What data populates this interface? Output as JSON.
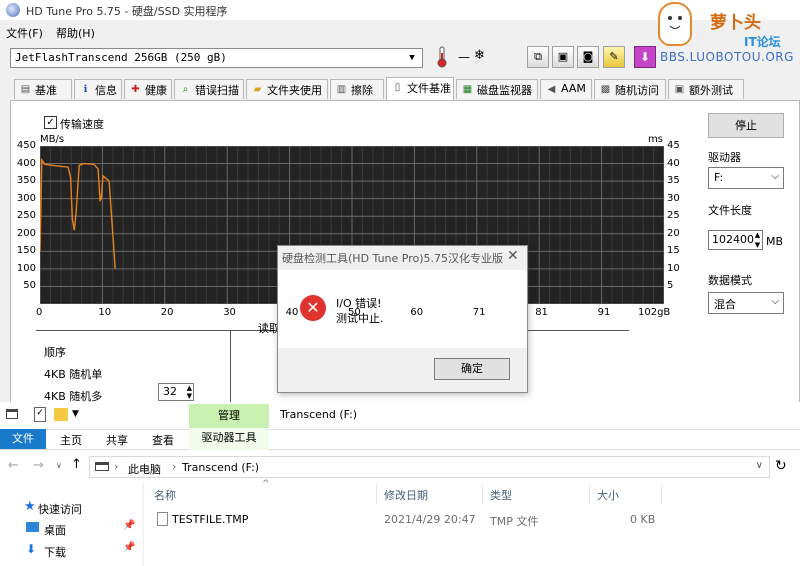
{
  "window": {
    "title": "HD Tune Pro 5.75 - 硬盘/SSD 实用程序",
    "menu": [
      "文件(F)",
      "帮助(H)"
    ],
    "drive": "JetFlashTranscend 256GB (250 gB)",
    "temperature": "—"
  },
  "watermark": {
    "title": "萝卜头",
    "subtitle": "IT论坛",
    "url": "BBS.LUOBOTOU.ORG"
  },
  "tabs": [
    {
      "label": "基准",
      "icon": "ruler-icon"
    },
    {
      "label": "信息",
      "icon": "info-icon"
    },
    {
      "label": "健康",
      "icon": "health-cross-icon"
    },
    {
      "label": "错误扫描",
      "icon": "magnifier-icon"
    },
    {
      "label": "文件夹使用",
      "icon": "folder-icon"
    },
    {
      "label": "擦除",
      "icon": "trash-icon"
    },
    {
      "label": "文件基准",
      "icon": "file-icon"
    },
    {
      "label": "磁盘监视器",
      "icon": "monitor-icon"
    },
    {
      "label": "AAM",
      "icon": "speaker-icon"
    },
    {
      "label": "随机访问",
      "icon": "random-icon"
    },
    {
      "label": "额外测试",
      "icon": "extra-icon"
    }
  ],
  "benchmark": {
    "checkbox_label": "传输速度",
    "checked": true,
    "left_unit": "MB/s",
    "right_unit": "ms",
    "section_label": "读取",
    "list_header": "顺序",
    "rows": [
      "4KB 随机单",
      "4KB 随机多"
    ],
    "queue_depth": "32"
  },
  "chart_data": {
    "type": "line",
    "xlabel": "",
    "ylabel": "MB/s",
    "y2label": "ms",
    "xlim": [
      0,
      102
    ],
    "ylim": [
      0,
      450
    ],
    "y2lim": [
      0,
      45
    ],
    "x_ticks": [
      "0",
      "10",
      "20",
      "30",
      "40",
      "50",
      "60",
      "71",
      "81",
      "91",
      "102gB"
    ],
    "y_ticks": [
      "450",
      "400",
      "350",
      "300",
      "250",
      "200",
      "150",
      "100",
      "50"
    ],
    "y2_ticks": [
      "45",
      "40",
      "35",
      "30",
      "25",
      "20",
      "15",
      "10",
      "5"
    ],
    "series": [
      {
        "color": "#e8821e",
        "x": [
          0.0,
          0.3,
          0.8,
          2.0,
          3.5,
          4.6,
          5.0,
          5.3,
          5.6,
          5.9,
          6.4,
          7.2,
          8.8,
          9.5,
          9.8,
          10.0,
          10.3,
          11.3,
          11.9,
          12.3
        ],
        "y": [
          150,
          410,
          398,
          395,
          392,
          390,
          360,
          240,
          210,
          260,
          395,
          400,
          398,
          385,
          295,
          300,
          365,
          350,
          200,
          100
        ]
      }
    ]
  },
  "side": {
    "stop_label": "停止",
    "drive_label": "驱动器",
    "drive_value": "F:",
    "file_length_label": "文件长度",
    "file_length_value": "102400",
    "file_length_unit": "MB",
    "data_mode_label": "数据模式",
    "data_mode_value": "混合"
  },
  "dialog": {
    "title": "硬盘检测工具(HD Tune Pro)5.75汉化专业版",
    "message_line1": "I/O 错误!",
    "message_line2": "测试中止.",
    "ok_label": "确定"
  },
  "explorer": {
    "context_tab": "管理",
    "window_title": "Transcend (F:)",
    "ribbon_tabs": [
      "文件",
      "主页",
      "共享",
      "查看",
      "驱动器工具"
    ],
    "breadcrumb": [
      "此电脑",
      "Transcend (F:)"
    ],
    "columns": [
      "名称",
      "修改日期",
      "类型",
      "大小"
    ],
    "nav": [
      {
        "label": "快速访问",
        "icon": "star-icon"
      },
      {
        "label": "桌面",
        "icon": "desktop-icon"
      },
      {
        "label": "下载",
        "icon": "download-icon"
      }
    ],
    "files": [
      {
        "name": "TESTFILE.TMP",
        "modified": "2021/4/29 20:47",
        "type": "TMP 文件",
        "size": "0 KB"
      }
    ]
  }
}
